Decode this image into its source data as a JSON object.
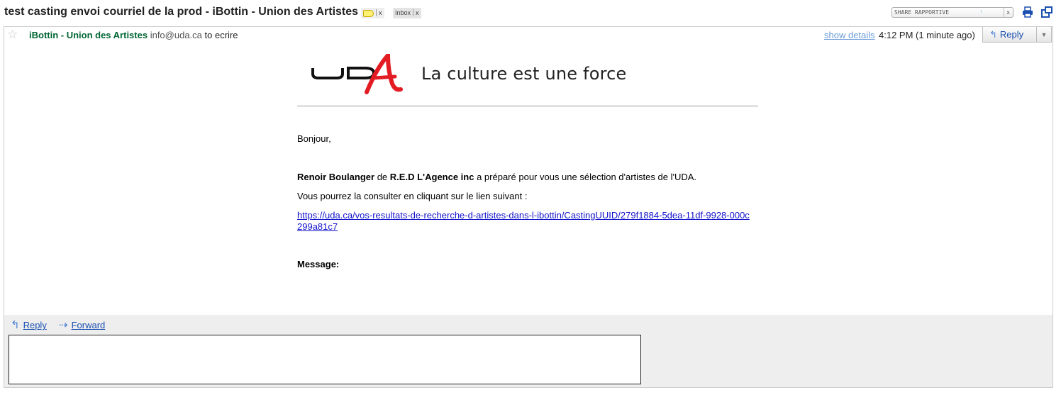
{
  "header": {
    "subject": "test casting envoi courriel de la prod - iBottin - Union des Artistes",
    "labels": [
      "Inbox"
    ],
    "close_x": "x",
    "rapportive": "SHARE RAPPORTIVE",
    "icons": [
      "label-tag-icon",
      "print-icon",
      "new-window-icon",
      "twitter-bird-icon"
    ]
  },
  "message": {
    "star": "☆",
    "sender_name": "iBottin - Union des Artistes",
    "sender_email": "info@uda.ca",
    "to": "to ecrire",
    "show_details": "show details",
    "time": "4:12 PM (1 minute ago)",
    "reply": "Reply",
    "more": "▼"
  },
  "body": {
    "logo_text": "UDA",
    "tagline": "La culture est une force",
    "greeting": "Bonjour,",
    "person": "Renoir Boulanger",
    "de": "de",
    "agency": "R.E.D L'Agence inc",
    "intro_rest": "a préparé pour vous une sélection d'artistes de l'UDA.",
    "consult": "Vous pourrez la consulter en cliquant sur le lien suivant :",
    "link": "https://uda.ca/vos-resultats-de-recherche-d-artistes-dans-l-ibottin/CastingUUID/279f1884-5dea-11df-9928-000c299a81c7",
    "message_label": "Message:"
  },
  "footer": {
    "reply": "Reply",
    "forward": "Forward",
    "reply_box_value": ""
  },
  "colors": {
    "sender": "#006633",
    "link": "#1111cc",
    "logo_red": "#e31b23"
  }
}
